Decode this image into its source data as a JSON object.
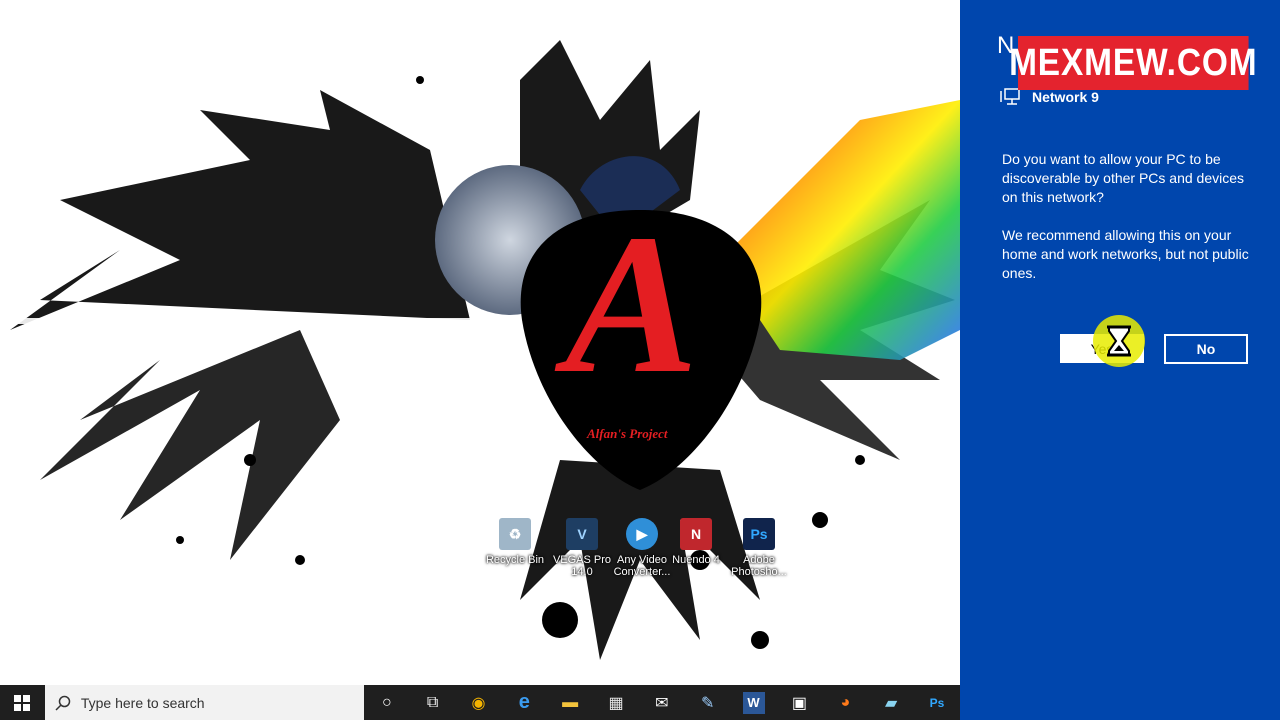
{
  "desktop": {
    "logo_text": "A",
    "logo_caption": "Alfan's Project",
    "icons": [
      {
        "label": "Recycle Bin",
        "icon": "recycle-bin-icon",
        "color": "#9fb6c8"
      },
      {
        "label": "VEGAS Pro 14.0",
        "icon": "vegas-pro-icon",
        "color": "#1e3e63"
      },
      {
        "label": "Any Video Converter...",
        "icon": "any-video-converter-icon",
        "color": "#2f8fd8"
      },
      {
        "label": "Nuendo 4",
        "icon": "nuendo-icon",
        "color": "#c0272d"
      },
      {
        "label": "Adobe Photosho...",
        "icon": "photoshop-icon",
        "color": "#10244c"
      }
    ]
  },
  "panel": {
    "title": "N",
    "network_name": "Network 9",
    "question": "Do you want to allow your PC to be discoverable by other PCs and devices on this network?",
    "recommendation": "We recommend allowing this on your home and work networks, but not public ones.",
    "yes_label": "Yes",
    "no_label": "No",
    "background": "#0046ad"
  },
  "watermark": {
    "text": "MEXMEW.COM",
    "color": "#e4232e"
  },
  "taskbar": {
    "search_placeholder": "Type here to search",
    "apps": [
      {
        "name": "cortana-icon",
        "glyph": "○"
      },
      {
        "name": "task-view-icon",
        "glyph": "⧉"
      },
      {
        "name": "chrome-icon",
        "glyph": "◉"
      },
      {
        "name": "edge-icon",
        "glyph": "e"
      },
      {
        "name": "file-explorer-icon",
        "glyph": "▬"
      },
      {
        "name": "store-icon",
        "glyph": "▦"
      },
      {
        "name": "mail-icon",
        "glyph": "✉"
      },
      {
        "name": "paint-icon",
        "glyph": "✎"
      },
      {
        "name": "word-icon",
        "glyph": "W"
      },
      {
        "name": "video-editor-icon",
        "glyph": "▣"
      },
      {
        "name": "firefox-icon",
        "glyph": "◕"
      },
      {
        "name": "notes-icon",
        "glyph": "▰"
      },
      {
        "name": "photoshop-taskbar-icon",
        "glyph": "Ps"
      }
    ]
  }
}
